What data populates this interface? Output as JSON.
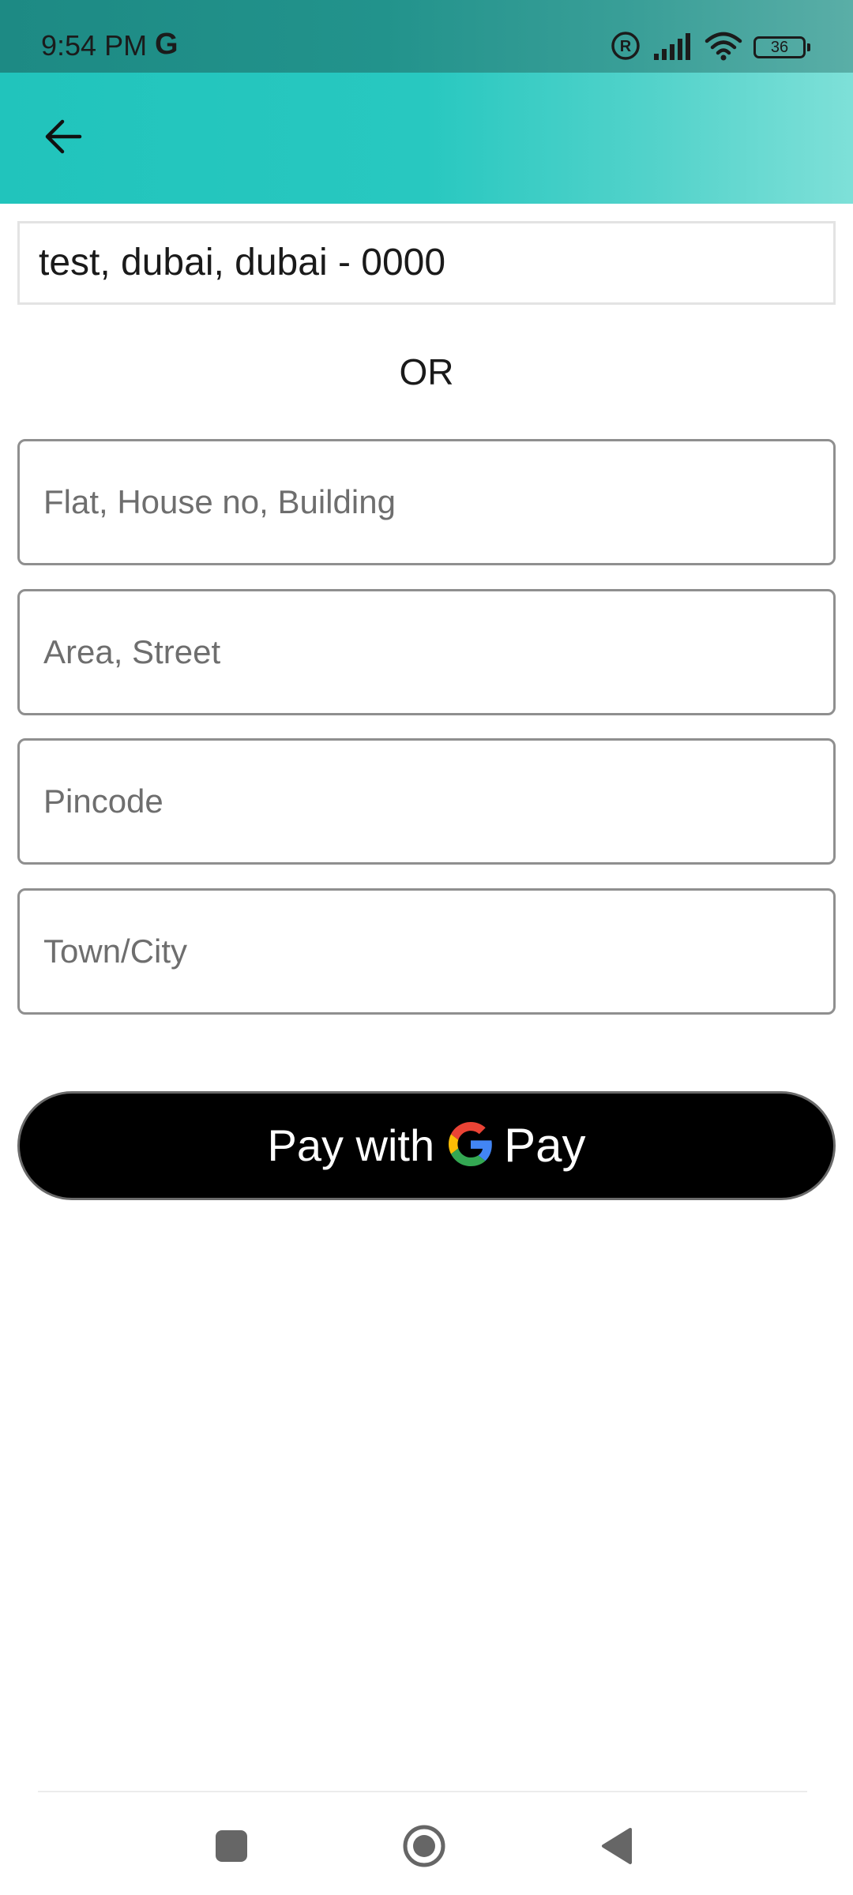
{
  "status_bar": {
    "time": "9:54 PM",
    "carrier_glyph": "G",
    "battery_level": "36",
    "icons": [
      "registered-icon",
      "signal-icon",
      "wifi-icon",
      "battery-icon"
    ]
  },
  "app_bar": {
    "back_icon": "arrow-left-icon",
    "accent_color": "#21c4bc"
  },
  "address": {
    "saved_value": "test, dubai, dubai - 0000"
  },
  "separator_label": "OR",
  "form": {
    "flat_placeholder": "Flat, House no, Building",
    "area_placeholder": "Area, Street",
    "pincode_placeholder": "Pincode",
    "city_placeholder": "Town/City"
  },
  "pay_button": {
    "label": "Pay with",
    "brand_suffix": "Pay",
    "icon": "google-g-icon"
  },
  "nav_bar": {
    "icons": [
      "recent-apps-icon",
      "home-icon",
      "back-icon"
    ]
  }
}
